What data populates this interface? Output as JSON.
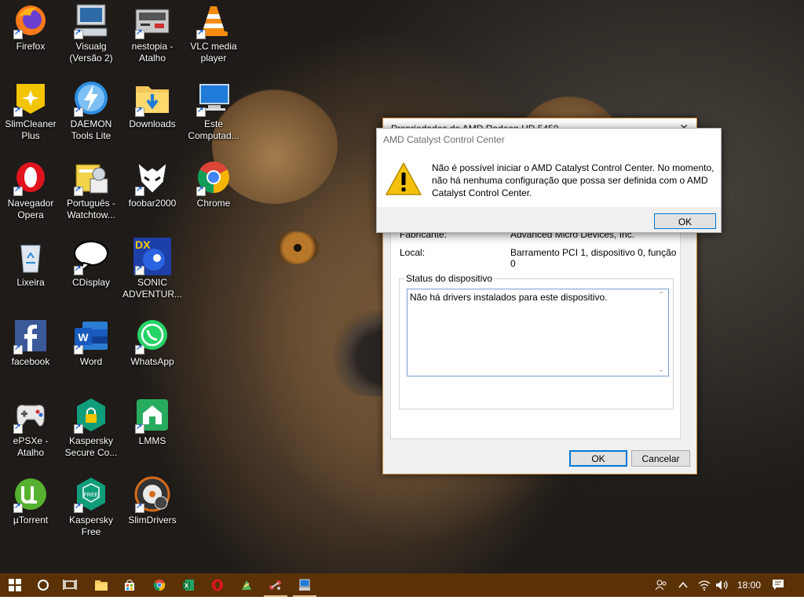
{
  "desktop_icons": [
    {
      "label": "Firefox"
    },
    {
      "label": "Visualg\n(Versão 2)"
    },
    {
      "label": "nestopia -\nAtalho"
    },
    {
      "label": "VLC media\nplayer"
    },
    {
      "label": "SlimCleaner\nPlus"
    },
    {
      "label": "DAEMON\nTools Lite"
    },
    {
      "label": "Downloads"
    },
    {
      "label": "Este\nComputad..."
    },
    {
      "label": "Navegador\nOpera"
    },
    {
      "label": "Português -\nWatchtow..."
    },
    {
      "label": "foobar2000"
    },
    {
      "label": "Chrome"
    },
    {
      "label": "Lixeira"
    },
    {
      "label": "CDisplay"
    },
    {
      "label": "SONIC\nADVENTUR..."
    },
    {
      "label": "facebook"
    },
    {
      "label": "Word"
    },
    {
      "label": "WhatsApp"
    },
    {
      "label": "ePSXe -\nAtalho"
    },
    {
      "label": "Kaspersky\nSecure Co..."
    },
    {
      "label": "LMMS"
    },
    {
      "label": "µTorrent"
    },
    {
      "label": "Kaspersky\nFree"
    },
    {
      "label": "SlimDrivers"
    }
  ],
  "properties_dialog": {
    "title": "Propriedades de AMD Radeon HD 5450",
    "manufacturer_label": "Fabricante:",
    "manufacturer_value": "Advanced Micro Devices, Inc.",
    "location_label": "Local:",
    "location_value": "Barramento PCI 1, dispositivo 0, função 0",
    "status_group_label": "Status do dispositivo",
    "status_text": "Não há drivers instalados para este dispositivo.",
    "ok_label": "OK",
    "cancel_label": "Cancelar"
  },
  "message_box": {
    "title": "AMD Catalyst Control Center",
    "message": "Não é possível iniciar o AMD Catalyst Control Center. No momento, não há nenhuma configuração que possa ser definida com o AMD Catalyst Control Center.",
    "ok_label": "OK",
    "icon": "warning-icon"
  },
  "taskbar": {
    "clock": "18:00",
    "accent_color": "#5b3206"
  }
}
